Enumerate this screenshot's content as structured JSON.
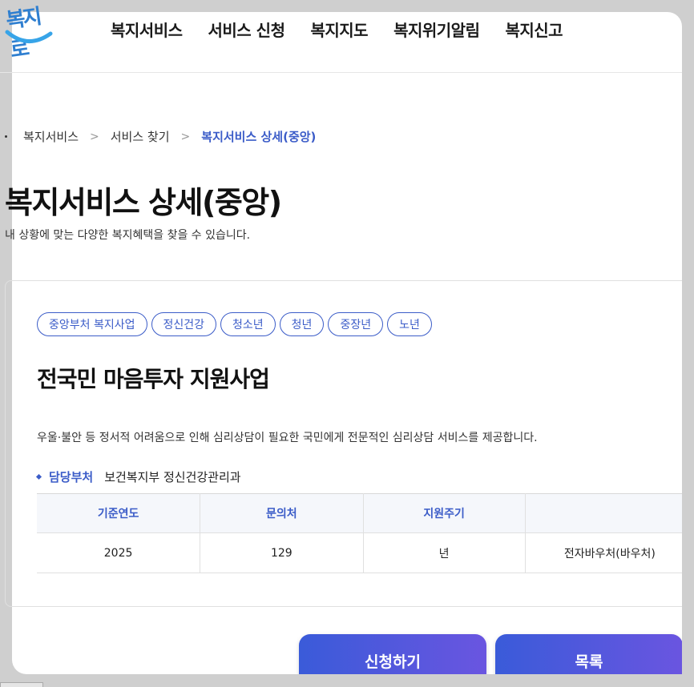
{
  "logo": {
    "text": "복지로",
    "brand_color": "#2f7fd0"
  },
  "nav": {
    "items": [
      {
        "label": "복지서비스"
      },
      {
        "label": "서비스 신청"
      },
      {
        "label": "복지지도"
      },
      {
        "label": "복지위기알림"
      },
      {
        "label": "복지신고"
      }
    ]
  },
  "breadcrumb": {
    "items": [
      "복지서비스",
      "서비스 찾기"
    ],
    "separator": ">",
    "current": "복지서비스 상세(중앙)"
  },
  "page": {
    "title": "복지서비스 상세(중앙)",
    "subtitle": "내 상황에 맞는 다양한 복지혜택을 찾을 수 있습니다."
  },
  "service": {
    "tags": [
      "중앙부처 복지사업",
      "정신건강",
      "청소년",
      "청년",
      "중장년",
      "노년"
    ],
    "title": "전국민 마음투자 지원사업",
    "description": "우울·불안 등 정서적 어려움으로 인해 심리상담이 필요한 국민에게 전문적인 심리상담 서비스를 제공합니다.",
    "dept_label": "담당부처",
    "dept_value": "보건복지부 정신건강관리과",
    "table": {
      "headers": [
        "기준연도",
        "문의처",
        "지원주기",
        ""
      ],
      "row": [
        "2025",
        "129",
        "년",
        "전자바우처(바우처)"
      ]
    }
  },
  "buttons": {
    "apply": "신청하기",
    "list": "목록"
  },
  "colors": {
    "accent": "#3b5cc8",
    "button_start": "#3a5bd9",
    "button_end": "#6a55e0"
  }
}
